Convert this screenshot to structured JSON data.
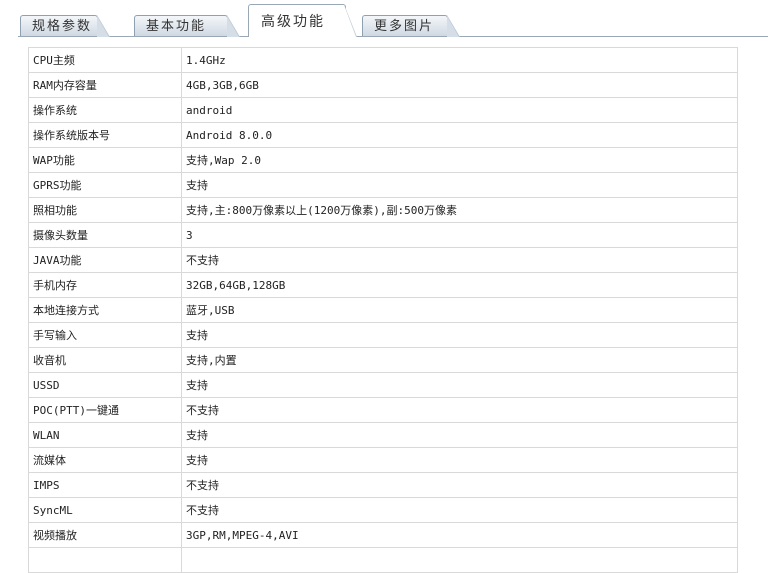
{
  "tabs": [
    {
      "label": "规格参数",
      "active": false
    },
    {
      "label": "基本功能",
      "active": false
    },
    {
      "label": "高级功能",
      "active": true
    },
    {
      "label": "更多图片",
      "active": false
    }
  ],
  "specs": [
    {
      "key": "CPU主频",
      "value": "1.4GHz"
    },
    {
      "key": "RAM内存容量",
      "value": "4GB,3GB,6GB"
    },
    {
      "key": "操作系统",
      "value": "android"
    },
    {
      "key": "操作系统版本号",
      "value": "Android 8.0.0"
    },
    {
      "key": "WAP功能",
      "value": "支持,Wap 2.0"
    },
    {
      "key": "GPRS功能",
      "value": "支持"
    },
    {
      "key": "照相功能",
      "value": "支持,主:800万像素以上(1200万像素),副:500万像素"
    },
    {
      "key": "摄像头数量",
      "value": "3"
    },
    {
      "key": "JAVA功能",
      "value": "不支持"
    },
    {
      "key": "手机内存",
      "value": "32GB,64GB,128GB"
    },
    {
      "key": "本地连接方式",
      "value": "蓝牙,USB"
    },
    {
      "key": "手写输入",
      "value": "支持"
    },
    {
      "key": "收音机",
      "value": "支持,内置"
    },
    {
      "key": "USSD",
      "value": "支持"
    },
    {
      "key": "POC(PTT)一键通",
      "value": "不支持"
    },
    {
      "key": "WLAN",
      "value": "支持"
    },
    {
      "key": "流媒体",
      "value": "支持"
    },
    {
      "key": "IMPS",
      "value": "不支持"
    },
    {
      "key": "SyncML",
      "value": "不支持"
    },
    {
      "key": "视频播放",
      "value": "3GP,RM,MPEG-4,AVI"
    },
    {
      "key": "",
      "value": ""
    }
  ]
}
